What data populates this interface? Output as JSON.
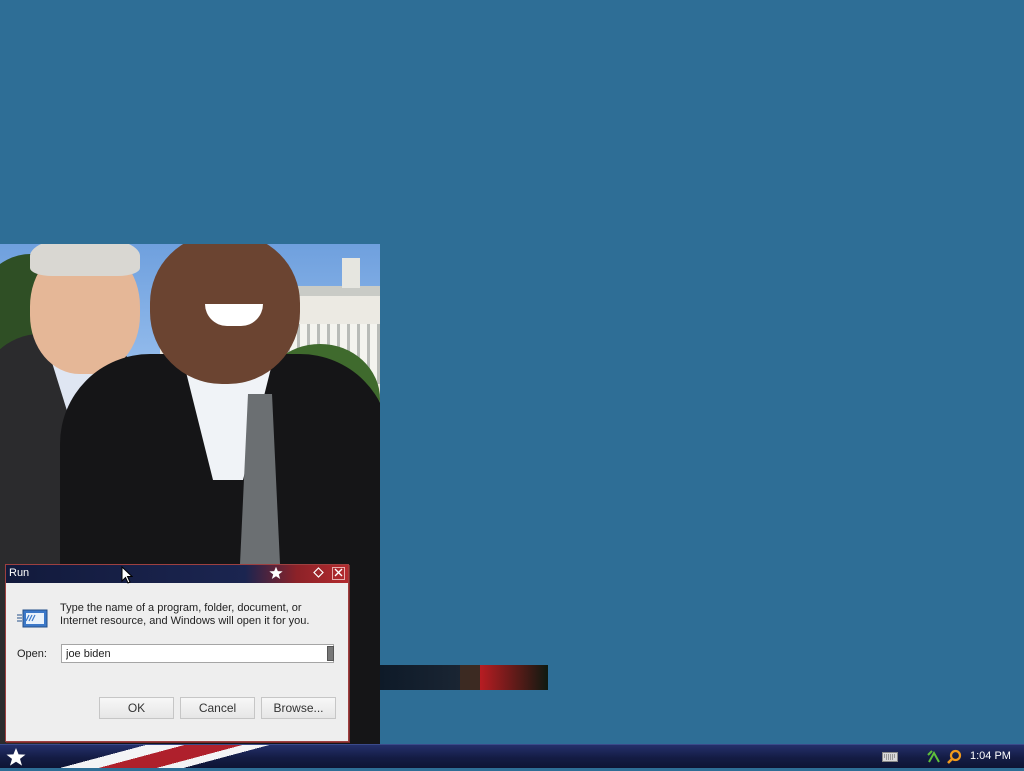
{
  "run_dialog": {
    "title": "Run",
    "description": "Type the name of a program, folder, document, or Internet resource, and Windows will open it for you.",
    "open_label": "Open:",
    "open_value": "joe biden",
    "ok_label": "OK",
    "cancel_label": "Cancel",
    "browse_label": "Browse..."
  },
  "taskbar": {
    "start_icon": "star-icon",
    "tray_icons": [
      "keyboard-icon",
      "network-icon",
      "search-icon"
    ],
    "clock": "1:04 PM"
  },
  "colors": {
    "desktop": "#2e6e96",
    "taskbar": "#141c44",
    "accent_red": "#b32a2e"
  }
}
